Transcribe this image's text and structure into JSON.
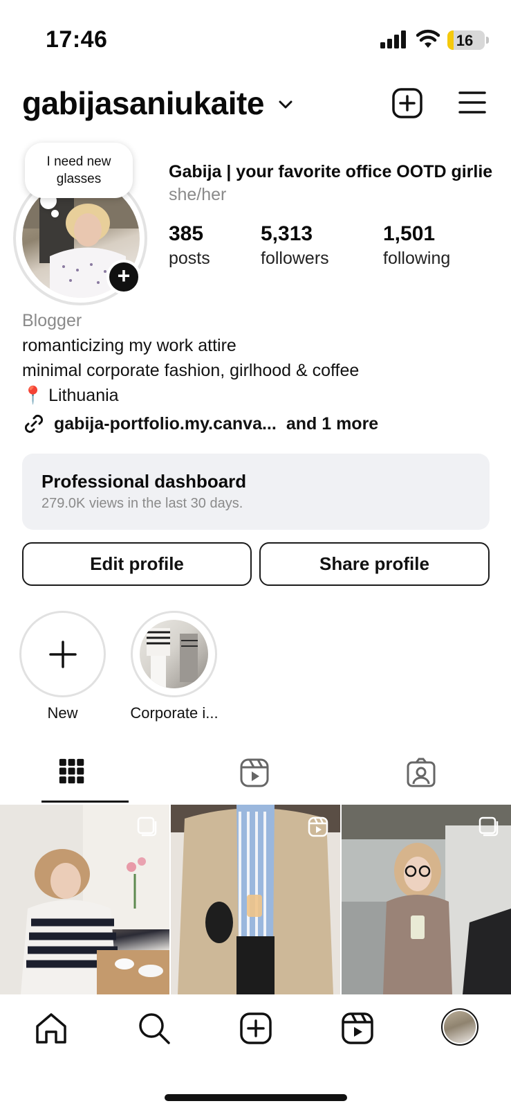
{
  "status_bar": {
    "time": "17:46",
    "battery_level": "16",
    "battery_color": "#f5c90c"
  },
  "header": {
    "username": "gabijasaniukaite",
    "icons": [
      "chevron-down-icon",
      "add-square-icon",
      "menu-icon"
    ]
  },
  "profile": {
    "note": "I need new glasses",
    "display_name": "Gabija | your favorite office OOTD girlie",
    "pronouns": "she/her",
    "stats": {
      "posts_count": "385",
      "posts_label": "posts",
      "followers_count": "5,313",
      "followers_label": "followers",
      "following_count": "1,501",
      "following_label": "following"
    },
    "bio": {
      "category": "Blogger",
      "line1": "romanticizing my work attire",
      "line2": "minimal corporate fashion, girlhood & coffee",
      "location": "📍 Lithuania"
    },
    "link": {
      "text": "gabija-portfolio.my.canva...",
      "more": "and 1 more"
    }
  },
  "dashboard": {
    "title": "Professional dashboard",
    "subtitle": "279.0K views in the last 30 days."
  },
  "actions": {
    "edit_label": "Edit profile",
    "share_label": "Share profile"
  },
  "highlights": [
    {
      "label": "New"
    },
    {
      "label": "Corporate i..."
    }
  ],
  "tabs": [
    "grid-icon",
    "reels-icon",
    "tagged-icon"
  ],
  "bottom_nav": [
    "home-icon",
    "search-icon",
    "create-icon",
    "reels-icon",
    "profile-avatar"
  ]
}
